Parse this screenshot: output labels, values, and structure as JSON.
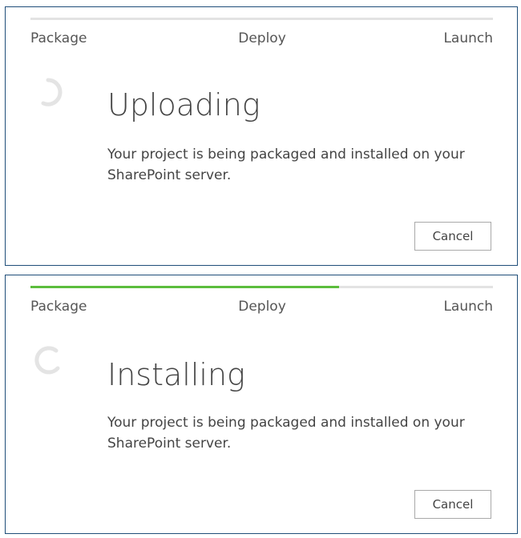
{
  "dialogs": [
    {
      "steps": {
        "package": "Package",
        "deploy": "Deploy",
        "launch": "Launch"
      },
      "progress_fraction": 0,
      "status_title": "Uploading",
      "status_message": "Your project is being packaged and installed on your SharePoint server.",
      "cancel_label": "Cancel",
      "spinner_icon": "loading-spinner-icon"
    },
    {
      "steps": {
        "package": "Package",
        "deploy": "Deploy",
        "launch": "Launch"
      },
      "progress_fraction": 0.667,
      "status_title": "Installing",
      "status_message": "Your project is being packaged and installed on your SharePoint server.",
      "cancel_label": "Cancel",
      "spinner_icon": "loading-spinner-icon"
    }
  ],
  "colors": {
    "progress_fill": "#5cbd3c",
    "progress_track": "#e3e3e3",
    "panel_border": "#1f4e79"
  }
}
